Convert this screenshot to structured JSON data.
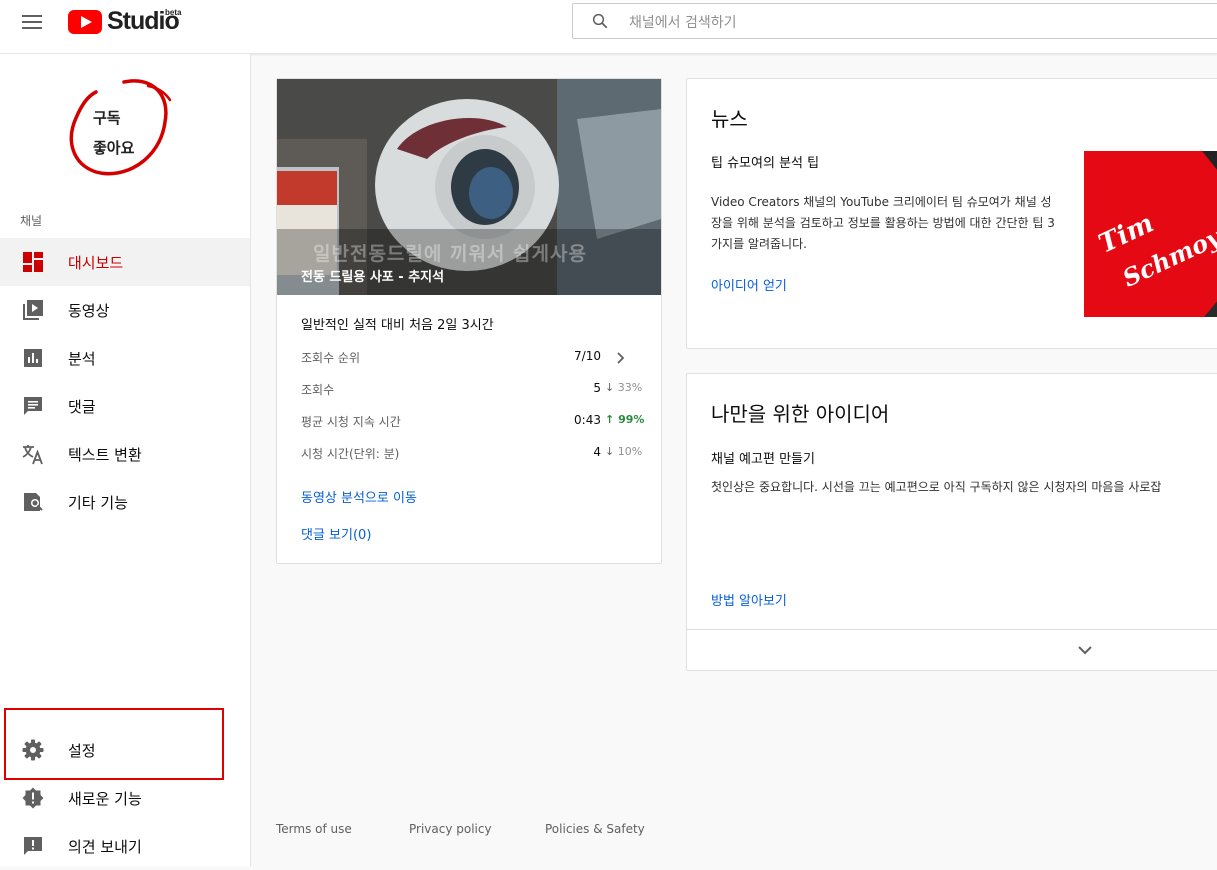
{
  "header": {
    "logo_text": "Studio",
    "logo_badge": "beta",
    "search_placeholder": "채널에서 검색하기"
  },
  "sidebar": {
    "channel_avatar": {
      "line1": "구독",
      "line2": "좋아요"
    },
    "section_label": "채널",
    "items": [
      {
        "label": "대시보드",
        "icon": "dashboard-icon",
        "active": true
      },
      {
        "label": "동영상",
        "icon": "video-library-icon"
      },
      {
        "label": "분석",
        "icon": "analytics-icon"
      },
      {
        "label": "댓글",
        "icon": "comments-icon"
      },
      {
        "label": "텍스트 변환",
        "icon": "translate-icon"
      },
      {
        "label": "기타 기능",
        "icon": "other-features-icon"
      }
    ],
    "bottom_items": [
      {
        "label": "설정",
        "icon": "gear-icon"
      },
      {
        "label": "새로운 기능",
        "icon": "whats-new-icon"
      },
      {
        "label": "의견 보내기",
        "icon": "feedback-icon"
      }
    ],
    "accent_color": "#cc0000",
    "highlight_color": "#e00000"
  },
  "video_card": {
    "thumbnail_overlay": "일반전동드릴에 끼워서 쉽게사용",
    "title": "전동 드릴용 사포 - 추지석",
    "performance_title": "일반적인 실적 대비 처음 2일 3시간",
    "stats": [
      {
        "label": "조회수 순위",
        "value": "7/10",
        "change": "",
        "direction": "link"
      },
      {
        "label": "조회수",
        "value": "5",
        "change": "33%",
        "direction": "down"
      },
      {
        "label": "평균 시청 지속 시간",
        "value": "0:43",
        "change": "99%",
        "direction": "up"
      },
      {
        "label": "시청 시간(단위: 분)",
        "value": "4",
        "change": "10%",
        "direction": "down"
      }
    ],
    "analytics_link": "동영상 분석으로 이동",
    "comments_link": "댓글 보기(0)"
  },
  "news_card": {
    "heading": "뉴스",
    "subtitle": "팁 슈모여의 분석 팁",
    "description": "Video Creators 채널의 YouTube 크리에이터 팀 슈모여가 채널 성장을 위해 분석을 검토하고 정보를 활용하는 방법에 대한 간단한 팁 3가지를 알려줍니다.",
    "link": "아이디어 얻기",
    "image_text_line1": "Tim",
    "image_text_line2": "Schmoyer"
  },
  "ideas_card": {
    "heading": "나만을 위한 아이디어",
    "subtitle": "채널 예고편 만들기",
    "description": "첫인상은 중요합니다. 시선을 끄는 예고편으로 아직 구독하지 않은 시청자의 마음을 사로잡",
    "link": "방법 알아보기"
  },
  "footer": {
    "links": [
      "Terms of use",
      "Privacy policy",
      "Policies & Safety"
    ]
  },
  "colors": {
    "link": "#065fd4",
    "up": "#2b8a3e",
    "logo_red": "#ff0000"
  }
}
